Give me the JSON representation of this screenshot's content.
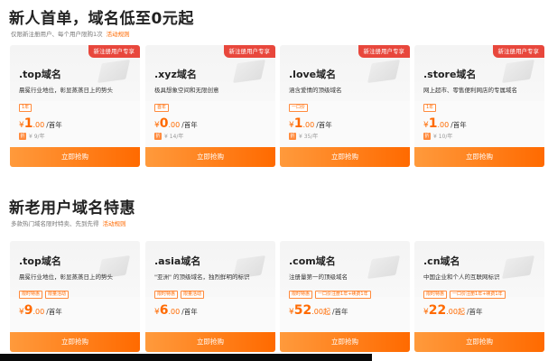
{
  "section1": {
    "title": "新人首单，域名低至0元起",
    "subtitle": "仅限新注册用户、每个用户限购1次",
    "rules_link": "活动规则",
    "cards": [
      {
        "ribbon": "新注册用户专享",
        "name": ".top域名",
        "desc": "晨冕行业地位，彰显蒸蒸日上的势头",
        "tags": [
          "1年"
        ],
        "currency": "¥",
        "price_int": "1",
        "price_dec": ".00",
        "unit": "/首年",
        "orig": "¥ 9/年",
        "button": "立即抢购"
      },
      {
        "ribbon": "新注册用户专享",
        "name": ".xyz域名",
        "desc": "极具想象空间和无限创意",
        "tags": [
          "首年"
        ],
        "currency": "¥",
        "price_int": "0",
        "price_dec": ".00",
        "unit": "/首年",
        "orig": "¥ 14/年",
        "button": "立即抢购"
      },
      {
        "ribbon": "新注册用户专享",
        "name": ".love域名",
        "desc": "涵含爱情的顶级域名",
        "tags": [
          "一口价"
        ],
        "currency": "¥",
        "price_int": "1",
        "price_dec": ".00",
        "unit": "/首年",
        "orig": "¥ 35/年",
        "button": "立即抢购"
      },
      {
        "ribbon": "新注册用户专享",
        "name": ".store域名",
        "desc": "网上超市、零售便利网店的专属域名",
        "tags": [
          "1年"
        ],
        "currency": "¥",
        "price_int": "1",
        "price_dec": ".00",
        "unit": "/首年",
        "orig": "¥ 10/年",
        "button": "立即抢购"
      }
    ]
  },
  "section2": {
    "title": "新老用户域名特惠",
    "subtitle": "多款热门域名限时特卖、先到先得",
    "rules_link": "活动规则",
    "cards": [
      {
        "name": ".top域名",
        "desc": "晨冕行业地位，彰显蒸蒸日上的势头",
        "tags": [
          "限时特惠",
          "限量活动"
        ],
        "currency": "¥",
        "price_int": "9",
        "price_dec": ".00",
        "unit": "/首年",
        "button": "立即抢购"
      },
      {
        "name": ".asia域名",
        "desc": "\"亚洲\" 的顶级域名，独烈鲜明的标识",
        "tags": [
          "限时特惠",
          "限量活动"
        ],
        "currency": "¥",
        "price_int": "6",
        "price_dec": ".00",
        "unit": "/首年",
        "button": "立即抢购"
      },
      {
        "name": ".com域名",
        "desc": "注册量第一的顶级域名",
        "tags": [
          "限时特惠",
          "一口价注册1年+续费1年"
        ],
        "currency": "¥",
        "price_int": "52",
        "price_dec": ".00起",
        "unit": "/首年",
        "button": "立即抢购"
      },
      {
        "name": ".cn域名",
        "desc": "中国企业和个人的互联网标识",
        "tags": [
          "限时特惠",
          "一口价注册1年+续费1年"
        ],
        "currency": "¥",
        "price_int": "22",
        "price_dec": ".00起",
        "unit": "/首年",
        "button": "立即抢购"
      }
    ]
  },
  "colors": {
    "accent": "#ff6a00",
    "ribbon": "#e8473c"
  }
}
